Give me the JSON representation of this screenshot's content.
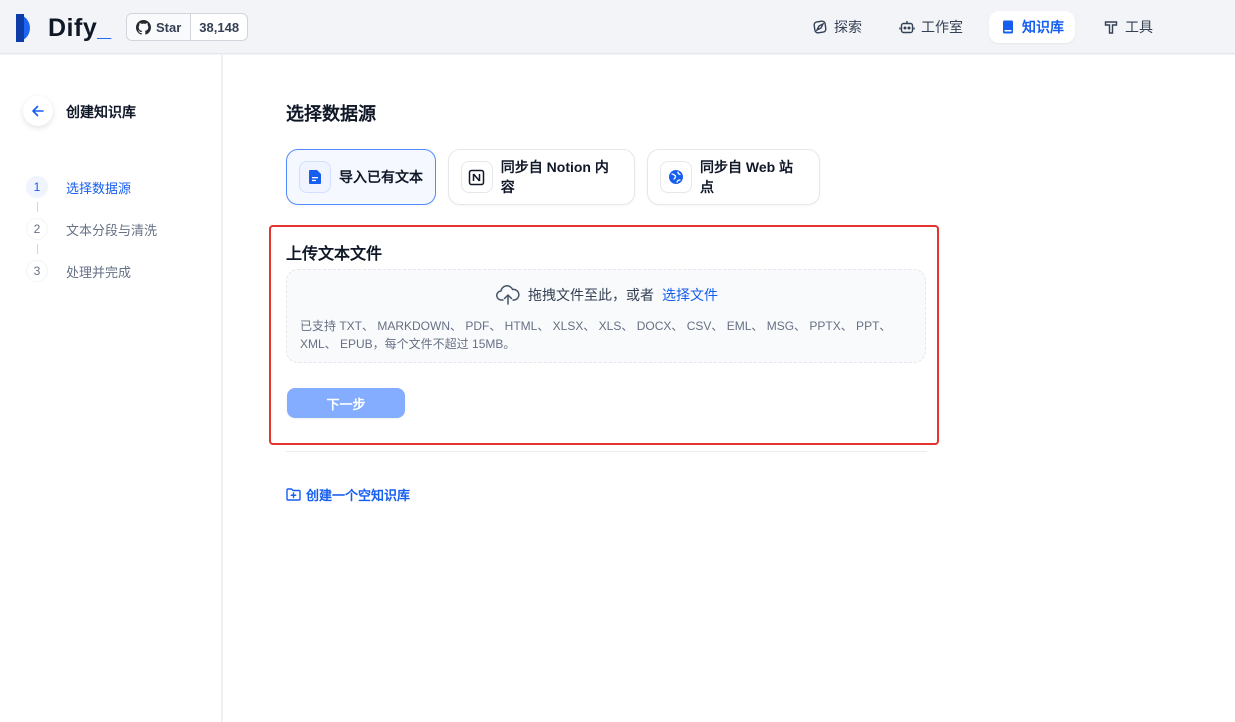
{
  "header": {
    "logo_text": "Dify",
    "github": {
      "star_label": "Star",
      "count": "38,148"
    },
    "nav": [
      {
        "label": "探索",
        "icon": "explore-icon",
        "active": false
      },
      {
        "label": "工作室",
        "icon": "robot-icon",
        "active": false
      },
      {
        "label": "知识库",
        "icon": "book-icon",
        "active": true
      },
      {
        "label": "工具",
        "icon": "tool-icon",
        "active": false
      }
    ]
  },
  "sidebar": {
    "back_icon": "arrow-left-icon",
    "title": "创建知识库",
    "steps": [
      {
        "num": "1",
        "label": "选择数据源",
        "active": true
      },
      {
        "num": "2",
        "label": "文本分段与清洗",
        "active": false
      },
      {
        "num": "3",
        "label": "处理并完成",
        "active": false
      }
    ]
  },
  "main": {
    "title": "选择数据源",
    "sources": [
      {
        "label": "导入已有文本",
        "icon": "file-text-icon",
        "active": true
      },
      {
        "label": "同步自 Notion 内容",
        "icon": "notion-icon",
        "active": false
      },
      {
        "label": "同步自 Web 站点",
        "icon": "globe-icon",
        "active": false
      }
    ],
    "upload": {
      "title": "上传文本文件",
      "drop_text": "拖拽文件至此，或者",
      "drop_link": "选择文件",
      "tip": "已支持 TXT、 MARKDOWN、 PDF、 HTML、 XLSX、 XLS、 DOCX、 CSV、 EML、 MSG、 PPTX、 PPT、 XML、 EPUB，每个文件不超过 15MB。"
    },
    "next_label": "下一步",
    "create_empty_label": "创建一个空知识库"
  },
  "colors": {
    "accent": "#155eef",
    "highlight_border": "#e3342f",
    "next_button": "#84adff"
  }
}
